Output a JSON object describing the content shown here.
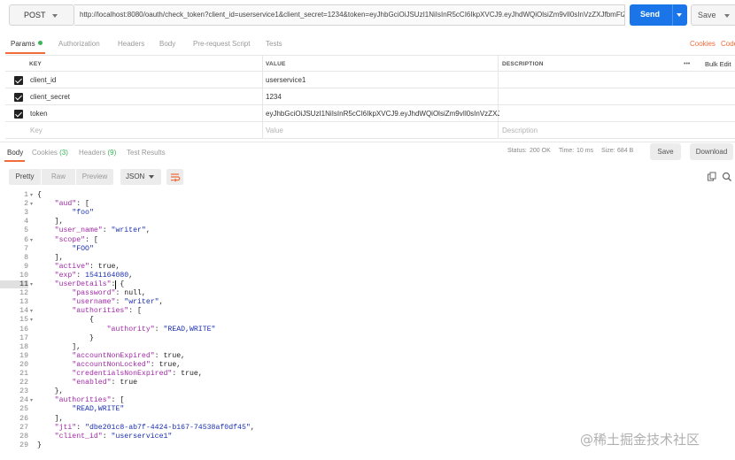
{
  "request": {
    "method": "POST",
    "url": "http://localhost:8080/oauth/check_token?client_id=userservice1&client_secret=1234&token=eyJhbGciOiJSUzI1NiIsInR5cCI6IkpXVCJ9.eyJhdWQiOlsiZm9vIl0sInVzZXJfbmFtZSI6I...",
    "send_label": "Send",
    "save_label": "Save"
  },
  "request_tabs": {
    "params": "Params",
    "authorization": "Authorization",
    "headers": "Headers",
    "body": "Body",
    "pre_request": "Pre-request Script",
    "tests": "Tests",
    "cookies": "Cookies",
    "code": "Code"
  },
  "params_table": {
    "headers": [
      "KEY",
      "VALUE",
      "DESCRIPTION"
    ],
    "more": "•••",
    "bulk_edit": "Bulk Edit",
    "rows": [
      {
        "key": "client_id",
        "value": "userservice1",
        "checked": true
      },
      {
        "key": "client_secret",
        "value": "1234",
        "checked": true
      },
      {
        "key": "token",
        "value": "eyJhbGciOiJSUzI1NiIsInR5cCI6IkpXVCJ9.eyJhdWQiOlsiZm9vIl0sInVzZXJfb...",
        "checked": true
      }
    ],
    "placeholders": {
      "key": "Key",
      "value": "Value",
      "description": "Description"
    }
  },
  "response": {
    "tabs": {
      "body": "Body",
      "cookies": "Cookies",
      "cookies_count": "(3)",
      "headers": "Headers",
      "headers_count": "(9)",
      "test_results": "Test Results"
    },
    "status_label": "Status:",
    "status_value": "200 OK",
    "time_label": "Time:",
    "time_value": "10 ms",
    "size_label": "Size:",
    "size_value": "684 B",
    "save_label": "Save",
    "download_label": "Download",
    "formats": {
      "pretty": "Pretty",
      "raw": "Raw",
      "preview": "Preview",
      "json": "JSON"
    }
  },
  "code_lines": [
    "{",
    "    \"aud\": [",
    "        \"foo\"",
    "    ],",
    "    \"user_name\": \"writer\",",
    "    \"scope\": [",
    "        \"FOO\"",
    "    ],",
    "    \"active\": true,",
    "    \"exp\": 1541164080,",
    "    \"userDetails\": {",
    "        \"password\": null,",
    "        \"username\": \"writer\",",
    "        \"authorities\": [",
    "            {",
    "                \"authority\": \"READ,WRITE\"",
    "            }",
    "        ],",
    "        \"accountNonExpired\": true,",
    "        \"accountNonLocked\": true,",
    "        \"credentialsNonExpired\": true,",
    "        \"enabled\": true",
    "    },",
    "    \"authorities\": [",
    "        \"READ,WRITE\"",
    "    ],",
    "    \"jti\": \"dbe201c8-ab7f-4424-b167-74538af0df45\",",
    "    \"client_id\": \"userservice1\"",
    "}"
  ],
  "foldable_lines": [
    1,
    2,
    6,
    11,
    14,
    15,
    24
  ],
  "watermark": "@稀土掘金技术社区",
  "colors": {
    "accent": "#f26b3a",
    "send": "#1a75e8",
    "status_ok": "#3cb55b",
    "json_key": "#a02aa6",
    "json_value": "#1a2fb0"
  },
  "icons": [
    "caret-down-icon",
    "checkbox-checked-icon",
    "wrap-lines-icon",
    "copy-icon",
    "search-icon"
  ]
}
